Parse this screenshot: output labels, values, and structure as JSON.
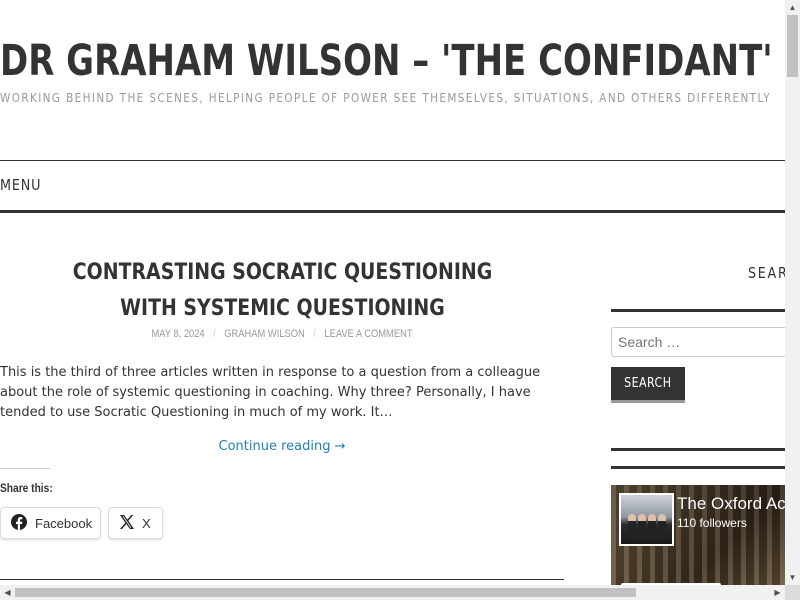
{
  "site": {
    "title": "DR GRAHAM WILSON – 'THE CONFIDANT'",
    "description": "WORKING BEHIND THE SCENES, HELPING PEOPLE OF POWER SEE THEMSELVES, SITUATIONS, AND OTHERS DIFFERENTLY"
  },
  "nav": {
    "menu_label": "MENU"
  },
  "post": {
    "title": "CONTRASTING SOCRATIC QUESTIONING WITH SYSTEMIC QUESTIONING",
    "date": "MAY 8, 2024",
    "author": "GRAHAM WILSON",
    "comments": "LEAVE A COMMENT",
    "separator": "/",
    "excerpt": "This is the third of three articles written in response to a question from a colleague about the role of systemic questioning in coaching.  Why three?  Personally, I have tended to use Socratic Questioning in much of my work.  It…",
    "continue_label": "Continue reading →",
    "share_label": "Share this:",
    "share_buttons": [
      {
        "label": "Facebook",
        "icon": "facebook-icon"
      },
      {
        "label": "X",
        "icon": "x-icon"
      }
    ]
  },
  "sidebar": {
    "search_widget_title": "SEARCH",
    "search_placeholder": "Search …",
    "search_button": "SEARCH",
    "facebook_widget": {
      "page_name": "The Oxford Academy",
      "followers": "110 followers"
    }
  },
  "colors": {
    "text": "#333333",
    "meta": "#999999",
    "link": "#1e7fb8",
    "button_bg": "#333333"
  }
}
